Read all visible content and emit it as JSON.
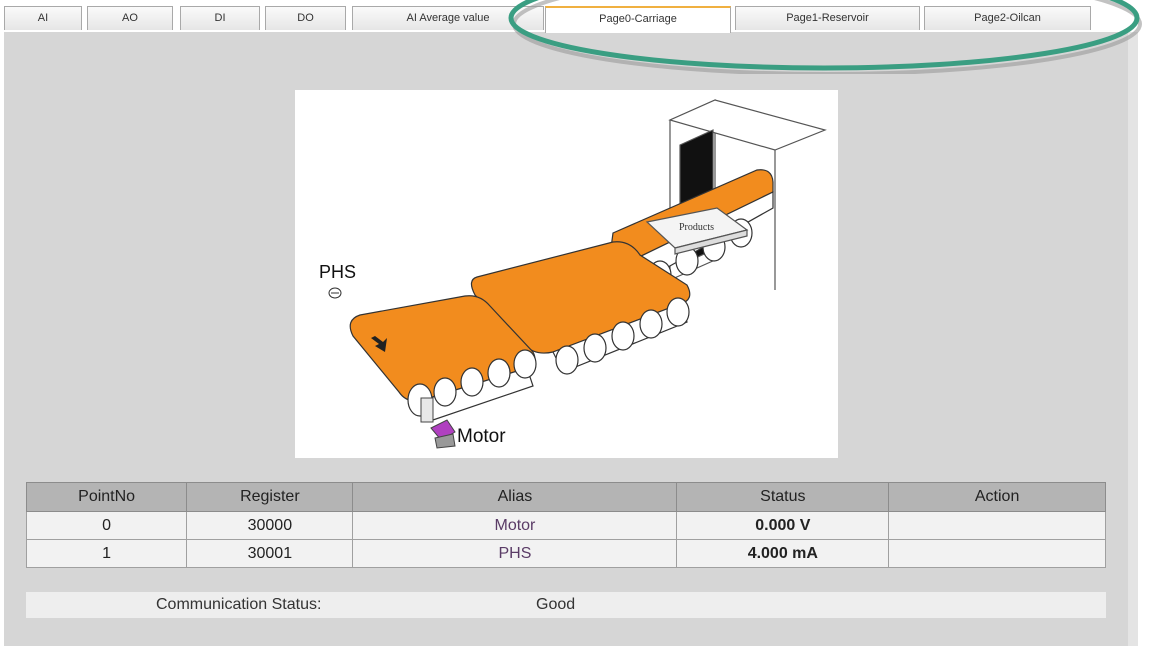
{
  "tabs": [
    {
      "label": "AI",
      "active": false
    },
    {
      "label": "AO",
      "active": false
    },
    {
      "label": "DI",
      "active": false
    },
    {
      "label": "DO",
      "active": false
    },
    {
      "label": "AI Average value",
      "active": false
    },
    {
      "label": "Page0-Carriage",
      "active": true
    },
    {
      "label": "Page1-Reservoir",
      "active": false
    },
    {
      "label": "Page2-Oilcan",
      "active": false
    }
  ],
  "figure": {
    "sensor_label": "PHS",
    "motor_label": "Motor",
    "box_label": "Products"
  },
  "table": {
    "headers": [
      "PointNo",
      "Register",
      "Alias",
      "Status",
      "Action"
    ],
    "rows": [
      {
        "point": "0",
        "register": "30000",
        "alias": "Motor",
        "status": "0.000 V",
        "action": ""
      },
      {
        "point": "1",
        "register": "30001",
        "alias": "PHS",
        "status": "4.000 mA",
        "action": ""
      }
    ]
  },
  "communication": {
    "label": "Communication Status:",
    "value": "Good"
  },
  "colors": {
    "belt": "#f28c1e",
    "highlight": "#3a9e82",
    "motor": "#b040c0"
  }
}
